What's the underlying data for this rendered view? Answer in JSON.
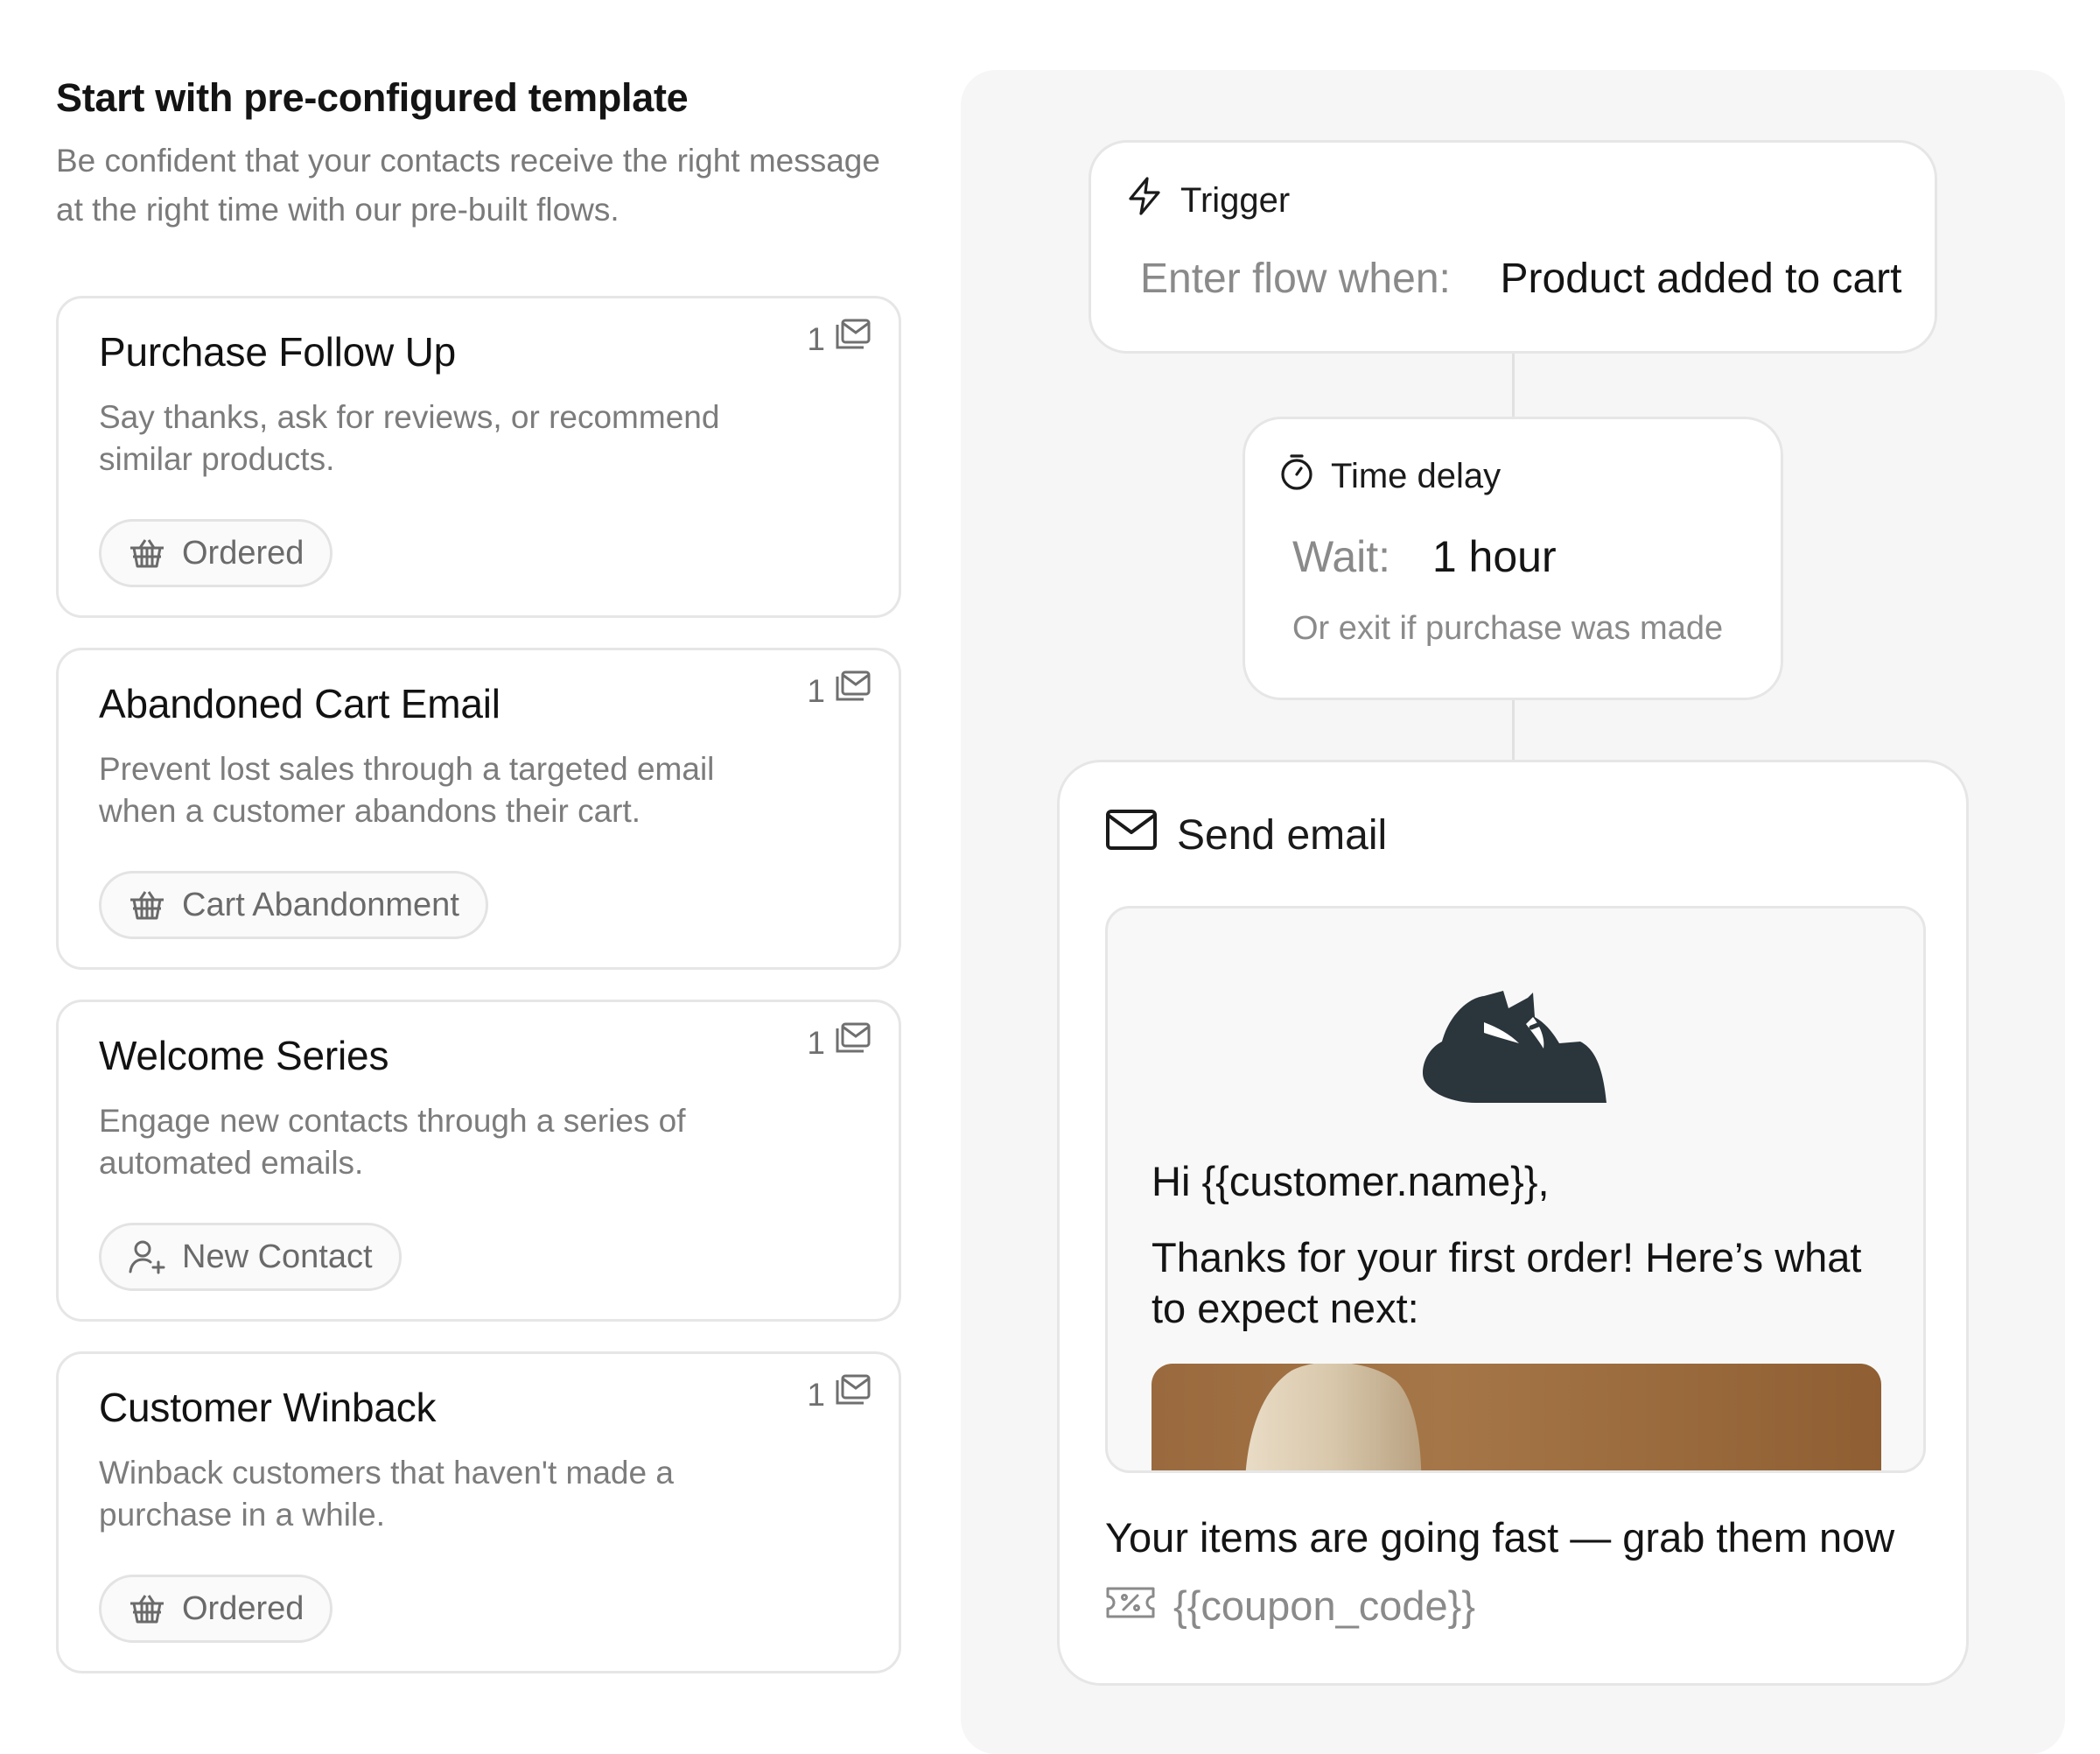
{
  "header": {
    "title": "Start with pre-configured template",
    "subtitle": "Be confident that your contacts receive the right message at the right time with our pre-built flows."
  },
  "templates": [
    {
      "title": "Purchase Follow Up",
      "description": "Say thanks, ask for reviews, or recommend similar products.",
      "count": "1",
      "tag": "Ordered",
      "tag_icon": "basket-icon"
    },
    {
      "title": "Abandoned Cart Email",
      "description": "Prevent lost sales through a targeted email when a customer abandons their cart.",
      "count": "1",
      "tag": "Cart Abandonment",
      "tag_icon": "basket-icon"
    },
    {
      "title": "Welcome Series",
      "description": "Engage new contacts through a series of automated emails.",
      "count": "1",
      "tag": "New Contact",
      "tag_icon": "user-plus-icon"
    },
    {
      "title": "Customer Winback",
      "description": "Winback customers that haven't made a purchase in a while.",
      "count": "1",
      "tag": "Ordered",
      "tag_icon": "basket-icon"
    }
  ],
  "flow": {
    "trigger": {
      "label": "Trigger",
      "condition_label": "Enter flow when:",
      "condition_value": "Product added to cart",
      "icon": "lightning-icon"
    },
    "delay": {
      "label": "Time delay",
      "wait_label": "Wait:",
      "wait_value": "1 hour",
      "exit_text": "Or exit if purchase was made",
      "icon": "timer-icon"
    },
    "email": {
      "label": "Send email",
      "icon": "mail-icon",
      "greeting": "Hi {{customer.name}},",
      "body": "Thanks for your first order! Here’s what to expect next:",
      "subject": "Your items are going fast — grab them now",
      "coupon": "{{coupon_code}}",
      "logo_icon": "cat-logo-icon"
    }
  },
  "colors": {
    "panel_bg": "#f6f6f6",
    "border": "#e6e6e6",
    "muted_text": "#7c7c7c",
    "logo": "#2a353c",
    "hero": "#a57647"
  }
}
